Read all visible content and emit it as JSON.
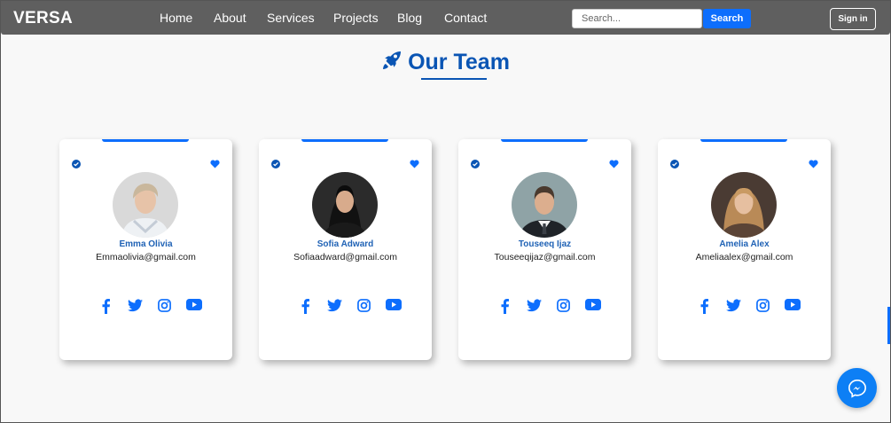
{
  "nav": {
    "brand": "VERSA",
    "links": [
      "Home",
      "About",
      "Services",
      "Projects",
      "Blog",
      "Contact"
    ],
    "search_placeholder": "Search...",
    "search_label": "Search",
    "signin_label": "Sign in"
  },
  "section": {
    "title": "Our Team"
  },
  "team": [
    {
      "name": "Emma Olivia",
      "email": "Emmaolivia@gmail.com"
    },
    {
      "name": "Sofia Adward",
      "email": "Sofiaadward@gmail.com"
    },
    {
      "name": "Touseeq Ijaz",
      "email": "Touseeqijaz@gmail.com"
    },
    {
      "name": "Amelia Alex",
      "email": "Ameliaalex@gmail.com"
    }
  ],
  "icons": {
    "rocket": "rocket-icon",
    "verified": "check-circle-icon",
    "heart": "heart-icon",
    "social": [
      "facebook-icon",
      "twitter-icon",
      "instagram-icon",
      "youtube-icon"
    ],
    "chat": "messenger-icon"
  },
  "colors": {
    "accent": "#0d6efd",
    "title": "#0a55b4",
    "navbar": "#5f5f5f"
  }
}
